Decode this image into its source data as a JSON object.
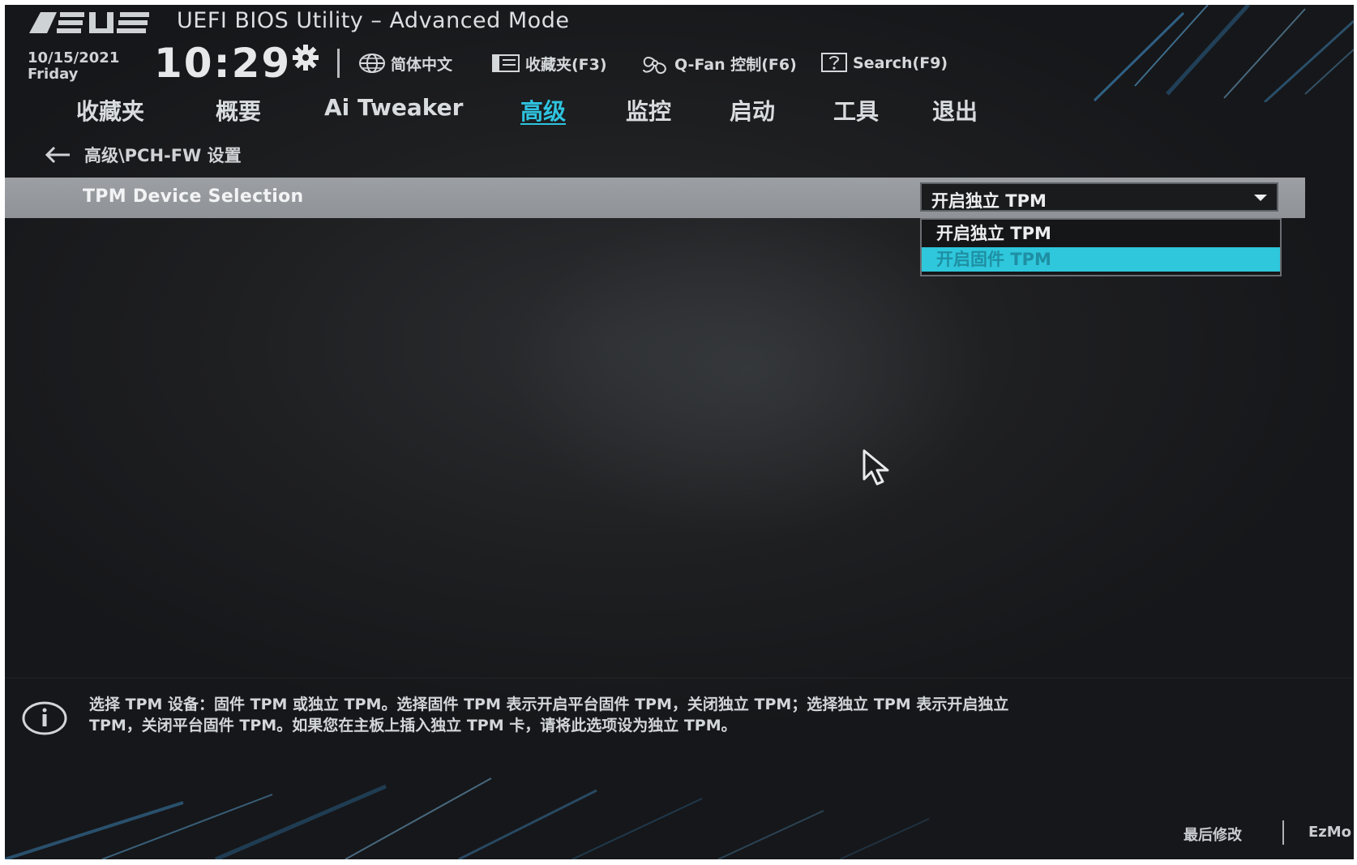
{
  "header": {
    "brand": "ASUS",
    "title": "UEFI BIOS Utility – Advanced Mode",
    "date": "10/15/2021",
    "day": "Friday",
    "time": "10:29"
  },
  "toolbar": {
    "language": "简体中文",
    "favorites": "收藏夹(F3)",
    "qfan": "Q-Fan 控制(F6)",
    "search": "Search(F9)"
  },
  "menu": {
    "items": [
      {
        "label": "收藏夹"
      },
      {
        "label": "概要"
      },
      {
        "label": "Ai Tweaker"
      },
      {
        "label": "高级"
      },
      {
        "label": "监控"
      },
      {
        "label": "启动"
      },
      {
        "label": "工具"
      },
      {
        "label": "退出"
      }
    ],
    "active_index": 3
  },
  "breadcrumb": "高级\\PCH-FW 设置",
  "setting": {
    "label": "TPM Device Selection",
    "value": "开启独立 TPM",
    "options": [
      "开启独立 TPM",
      "开启固件 TPM"
    ],
    "highlighted_index": 1
  },
  "help": {
    "line1": "选择 TPM 设备：固件 TPM 或独立 TPM。选择固件 TPM 表示开启平台固件 TPM，关闭独立 TPM；选择独立 TPM 表示开启独立",
    "line2": "TPM，关闭平台固件 TPM。如果您在主板上插入独立 TPM 卡，请将此选项设为独立 TPM。"
  },
  "footer": {
    "last_modified": "最后修改",
    "ez_mode": "EzMo"
  },
  "colors": {
    "accent": "#2ec4e0",
    "background": "#1e1f21",
    "selected_row": "#9c9fa3"
  },
  "icons": [
    "gear-icon",
    "globe-icon",
    "favorites-icon",
    "fan-icon",
    "search-help-icon",
    "back-arrow-icon",
    "dropdown-caret-icon",
    "info-icon",
    "mouse-cursor-icon"
  ]
}
